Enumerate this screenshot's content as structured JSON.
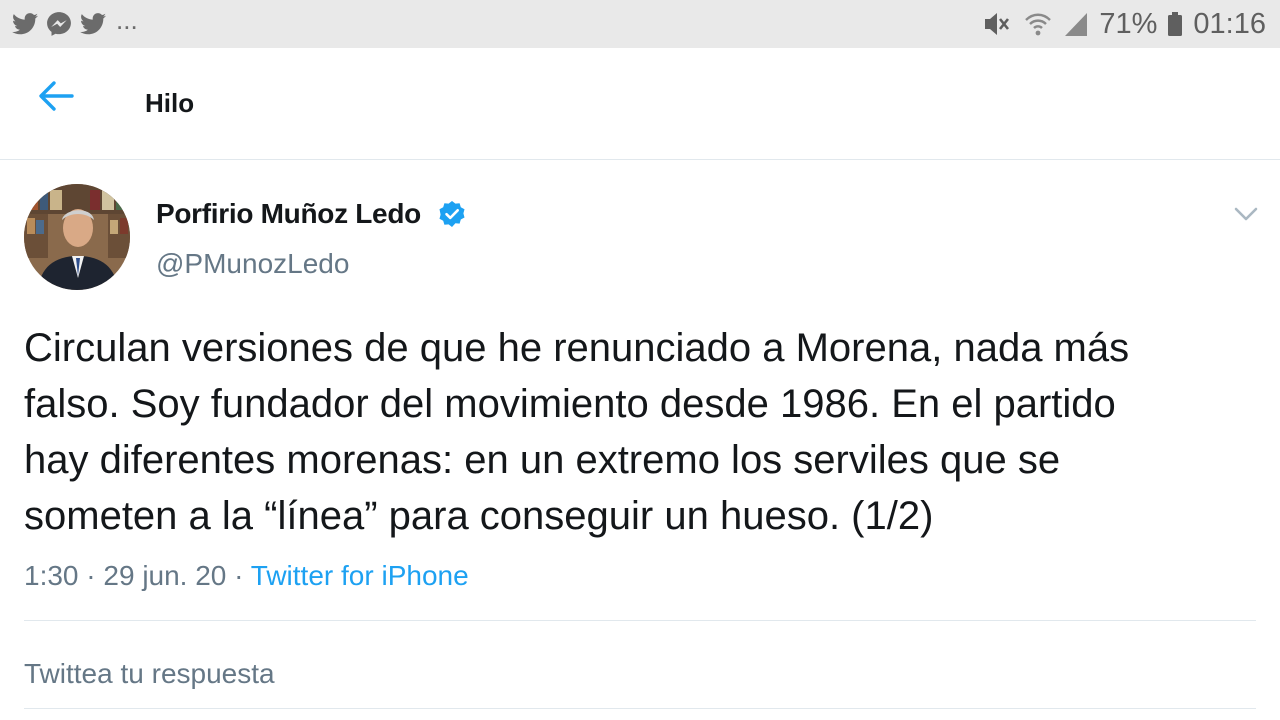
{
  "status_bar": {
    "left_icons": [
      "twitter-icon",
      "messenger-icon",
      "twitter-icon"
    ],
    "overflow": "...",
    "battery_percent": "71%",
    "time": "01:16"
  },
  "header": {
    "title": "Hilo"
  },
  "tweet": {
    "author_name": "Porfirio Muñoz Ledo",
    "handle": "@PMunozLedo",
    "verified": true,
    "lines": [
      "Circulan versiones de que he renunciado a Morena, nada más",
      "falso. Soy fundador del movimiento desde 1986. En el partido",
      "hay diferentes morenas: en un extremo los serviles que se",
      "someten a la “línea” para conseguir un hueso. (1/2)"
    ],
    "time": "1:30",
    "separator": " · ",
    "date": "29 jun. 20",
    "source": "Twitter for iPhone"
  },
  "reply": {
    "placeholder": "Twittea tu respuesta"
  },
  "colors": {
    "accent": "#1da1f2",
    "text": "#14171a",
    "secondary": "#657786",
    "divider": "#e1e8ed",
    "status_bar_bg": "#e9e9e9"
  }
}
